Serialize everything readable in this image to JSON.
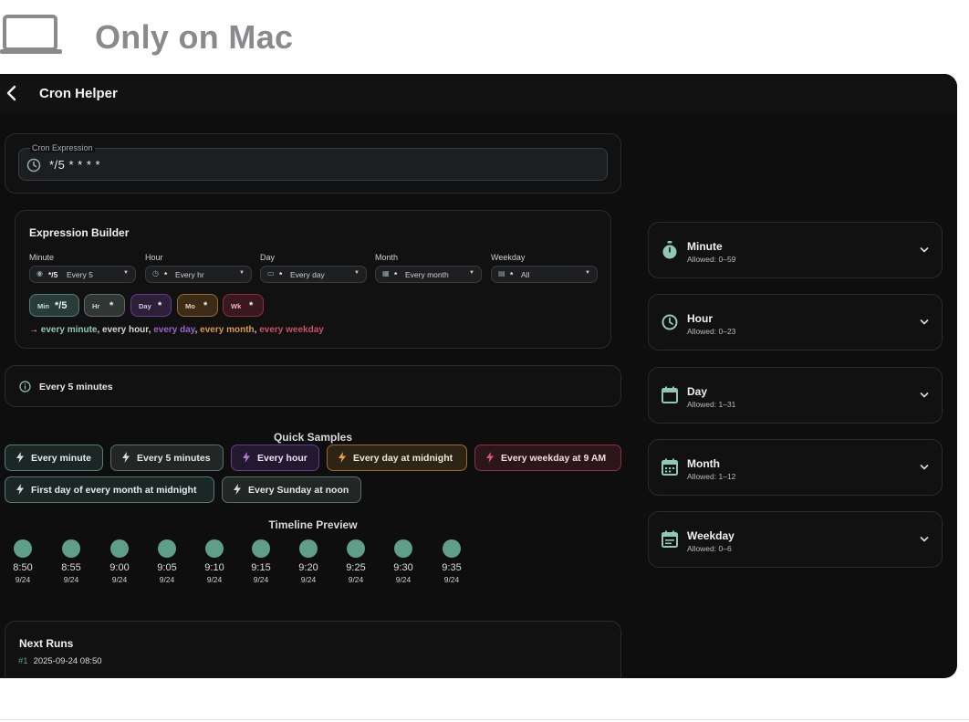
{
  "caption": {
    "text": "Only on Mac"
  },
  "app": {
    "title": "Cron Helper"
  },
  "cron": {
    "label": "Cron Expression",
    "value": "*/5 * * * *"
  },
  "builder": {
    "title": "Expression Builder",
    "fields": [
      {
        "label": "Minute",
        "value": "*/5",
        "text": "Every 5"
      },
      {
        "label": "Hour",
        "value": "*",
        "text": "Every hr"
      },
      {
        "label": "Day",
        "value": "*",
        "text": "Every day"
      },
      {
        "label": "Month",
        "value": "*",
        "text": "Every month"
      },
      {
        "label": "Weekday",
        "value": "*",
        "text": "All"
      }
    ],
    "chips": [
      {
        "key": "Min",
        "value": "*/5",
        "color": "#4e7f72"
      },
      {
        "key": "Hr",
        "value": "*",
        "color": "#5d6e6a"
      },
      {
        "key": "Day",
        "value": "*",
        "color": "#6b3a8c"
      },
      {
        "key": "Mo",
        "value": "*",
        "color": "#9a6a2c"
      },
      {
        "key": "Wk",
        "value": "*",
        "color": "#8a2f44"
      }
    ],
    "summary": {
      "arrow": "→",
      "minute": "every minute",
      "sep1": ",",
      "hour": "every hour",
      "sep2": ",",
      "day": "every day",
      "sep3": ",",
      "month": "every month",
      "sep4": ",",
      "weekday": "every weekday"
    }
  },
  "description": {
    "text": "Every 5 minutes"
  },
  "quick_samples": {
    "title": "Quick Samples",
    "items": [
      {
        "label": "Every minute",
        "color": "#4e7f72"
      },
      {
        "label": "Every 5 minutes",
        "color": "#5d6e6a"
      },
      {
        "label": "Every hour",
        "color": "#6b3a8c"
      },
      {
        "label": "Every day at midnight",
        "color": "#9a6a2c"
      },
      {
        "label": "Every weekday at 9 AM",
        "color": "#8a2f44"
      },
      {
        "label": "First day of every month at midnight",
        "color": "#4e7f72"
      },
      {
        "label": "Every Sunday at noon",
        "color": "#5d6e6a"
      }
    ]
  },
  "timeline": {
    "title": "Timeline Preview",
    "items": [
      {
        "time": "8:50",
        "date": "9/24"
      },
      {
        "time": "8:55",
        "date": "9/24"
      },
      {
        "time": "9:00",
        "date": "9/24"
      },
      {
        "time": "9:05",
        "date": "9/24"
      },
      {
        "time": "9:10",
        "date": "9/24"
      },
      {
        "time": "9:15",
        "date": "9/24"
      },
      {
        "time": "9:20",
        "date": "9/24"
      },
      {
        "time": "9:25",
        "date": "9/24"
      },
      {
        "time": "9:30",
        "date": "9/24"
      },
      {
        "time": "9:35",
        "date": "9/24"
      }
    ]
  },
  "next_runs": {
    "title": "Next Runs",
    "items": [
      {
        "index": "#1",
        "value": "2025-09-24 08:50"
      }
    ]
  },
  "field_panels": [
    {
      "name": "Minute",
      "allowed": "Allowed: 0–59",
      "icon": "stopwatch-icon"
    },
    {
      "name": "Hour",
      "allowed": "Allowed: 0–23",
      "icon": "clock-icon"
    },
    {
      "name": "Day",
      "allowed": "Allowed: 1–31",
      "icon": "calendar-icon"
    },
    {
      "name": "Month",
      "allowed": "Allowed: 1–12",
      "icon": "calendar-month-icon"
    },
    {
      "name": "Weekday",
      "allowed": "Allowed: 0–6",
      "icon": "calendar-week-icon"
    }
  ]
}
